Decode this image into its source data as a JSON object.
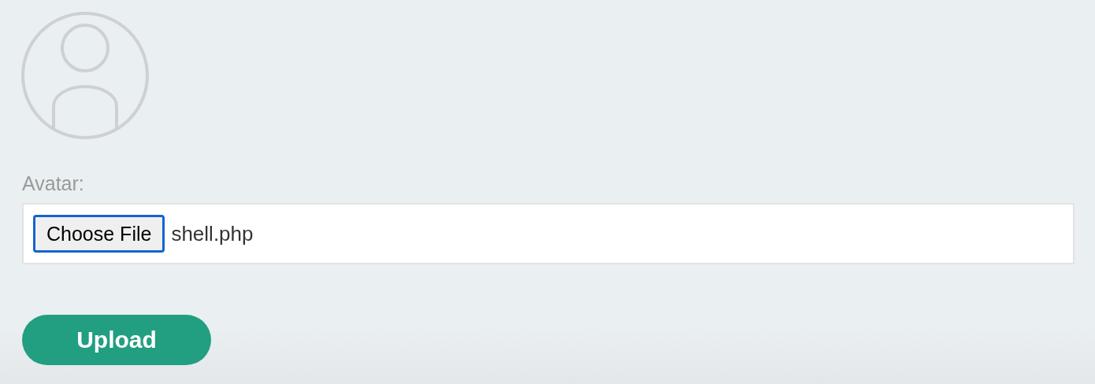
{
  "avatar_label": "Avatar:",
  "file_input": {
    "button_label": "Choose File",
    "file_name": "shell.php",
    "focused": true
  },
  "upload_button": "Upload"
}
